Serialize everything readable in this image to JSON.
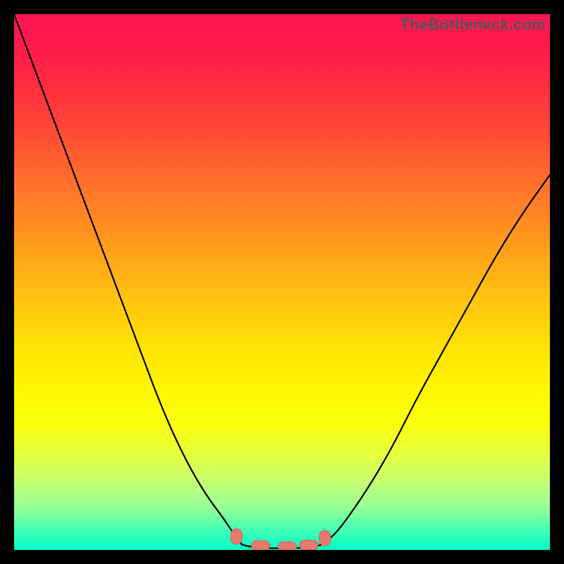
{
  "watermark": "TheBottleneck.com",
  "colors": {
    "gradient_top": "#ff1452",
    "gradient_bottom": "#00ffc8",
    "curve": "#000000",
    "marker": "#e97a6e"
  },
  "chart_data": {
    "type": "line",
    "title": "",
    "xlabel": "",
    "ylabel": "",
    "xlim": [
      0,
      100
    ],
    "ylim": [
      0,
      100
    ],
    "grid": false,
    "legend": false,
    "note": "V-shaped curve over rainbow gradient; axis values are estimated from pixel positions since no tick labels are shown.",
    "series": [
      {
        "name": "left-branch",
        "x": [
          0,
          3,
          6,
          9,
          12,
          15,
          18,
          21,
          24,
          27,
          30,
          33,
          36,
          39,
          41,
          42.5
        ],
        "values": [
          100,
          92,
          84,
          76,
          68,
          60,
          52,
          44,
          36,
          28,
          21,
          15,
          10,
          6,
          3,
          1
        ]
      },
      {
        "name": "valley",
        "x": [
          42.5,
          44,
          46,
          48,
          50,
          52,
          54,
          56,
          57.5
        ],
        "values": [
          1,
          0.6,
          0.4,
          0.3,
          0.3,
          0.3,
          0.4,
          0.6,
          1
        ]
      },
      {
        "name": "right-branch",
        "x": [
          57.5,
          60,
          63,
          67,
          71,
          75,
          80,
          85,
          90,
          95,
          100
        ],
        "values": [
          1,
          3,
          7,
          13,
          20,
          28,
          37,
          46,
          55,
          63,
          70
        ]
      }
    ],
    "markers": [
      {
        "x": 41.5,
        "y": 2.5,
        "label": ""
      },
      {
        "x": 46.0,
        "y": 0.8,
        "label": ""
      },
      {
        "x": 51.0,
        "y": 0.6,
        "label": ""
      },
      {
        "x": 55.0,
        "y": 0.9,
        "label": ""
      },
      {
        "x": 58.0,
        "y": 2.2,
        "label": ""
      }
    ]
  }
}
